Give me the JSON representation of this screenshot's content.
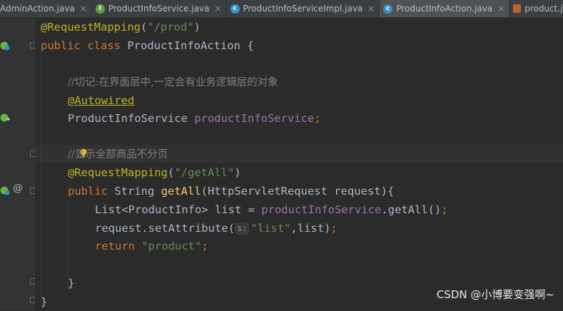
{
  "tabs": [
    {
      "label": "AdminAction.java",
      "icon": "class-icon",
      "active": false
    },
    {
      "label": "ProductInfoService.java",
      "icon": "interface-icon",
      "active": false
    },
    {
      "label": "ProductInfoServiceImpl.java",
      "icon": "class-icon",
      "active": false
    },
    {
      "label": "ProductInfoAction.java",
      "icon": "class-icon",
      "active": true
    },
    {
      "label": "product.jsp",
      "icon": "jsp-file-icon",
      "active": false
    }
  ],
  "tab_close_glyph": "×",
  "tab_icon_letters": {
    "class": "c",
    "interface": "I"
  },
  "code": {
    "l1_ann": "@RequestMapping",
    "l1_open": "(",
    "l1_str": "\"/prod\"",
    "l1_close": ")",
    "l2_kw": "public class ",
    "l2_name": "ProductInfoAction {",
    "l4_comment": "//切记:在界面层中,一定会有业务逻辑层的对象",
    "l5_ann": "@Autowired",
    "l6_type": "ProductInfoService ",
    "l6_field": "productInfoService",
    "l6_semi": ";",
    "l8_comment": "//显示全部商品不分页",
    "l9_ann": "@RequestMapping",
    "l9_open": "(",
    "l9_str": "\"/getAll\"",
    "l9_close": ")",
    "l10_kw1": "public ",
    "l10_type": "String ",
    "l10_method": "getAll",
    "l10_params": "(HttpServletRequest request){",
    "l11_type": "List<ProductInfo> list = ",
    "l11_field": "productInfoService",
    "l11_call": ".getAll()",
    "l11_semi": ";",
    "l12_call": "request.setAttribute(",
    "l12_hint": "s:",
    "l12_str": "\"list\"",
    "l12_rest": ",list)",
    "l12_semi": ";",
    "l13_kw": "return ",
    "l13_str": "\"product\"",
    "l13_semi": ";",
    "l15_brace": "}",
    "l16_brace": "}"
  },
  "gutter": {
    "at_symbol": "@"
  },
  "watermark": "CSDN @小博要变强啊~",
  "colors": {
    "background": "#2b2b2b",
    "keyword": "#cc7832",
    "annotation": "#bbb529",
    "string": "#6a8759",
    "field": "#9876aa",
    "method": "#ffc66d",
    "comment": "#808080"
  }
}
